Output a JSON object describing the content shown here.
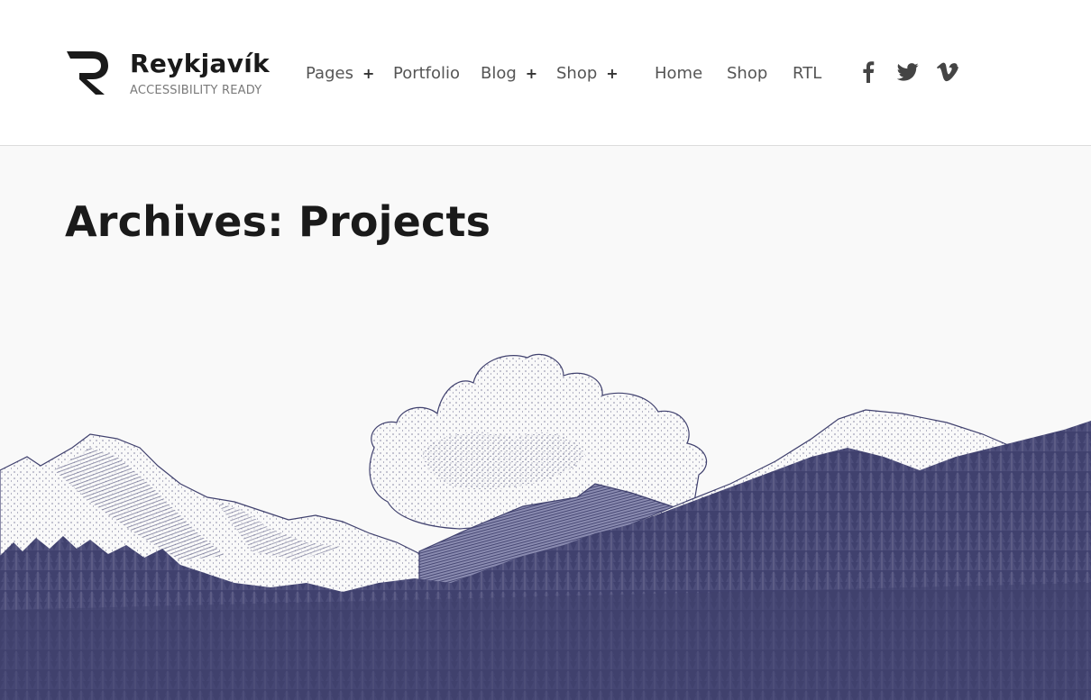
{
  "brand": {
    "title": "Reykjavík",
    "tagline": "ACCESSIBILITY READY"
  },
  "nav": {
    "items": [
      {
        "label": "Pages",
        "has_submenu": true
      },
      {
        "label": "Portfolio",
        "has_submenu": false
      },
      {
        "label": "Blog",
        "has_submenu": true
      },
      {
        "label": "Shop",
        "has_submenu": true
      },
      {
        "label": "Home",
        "has_submenu": false
      },
      {
        "label": "Shop",
        "has_submenu": false
      },
      {
        "label": "RTL",
        "has_submenu": false
      }
    ],
    "submenu_indicator": "+"
  },
  "social": {
    "icons": [
      "facebook-icon",
      "twitter-icon",
      "vimeo-icon"
    ]
  },
  "main": {
    "title": "Archives: Projects"
  },
  "colors": {
    "text": "#1a1a1a",
    "nav_text": "#555555",
    "background": "#f9f9f9",
    "illustration": "#40416e"
  }
}
